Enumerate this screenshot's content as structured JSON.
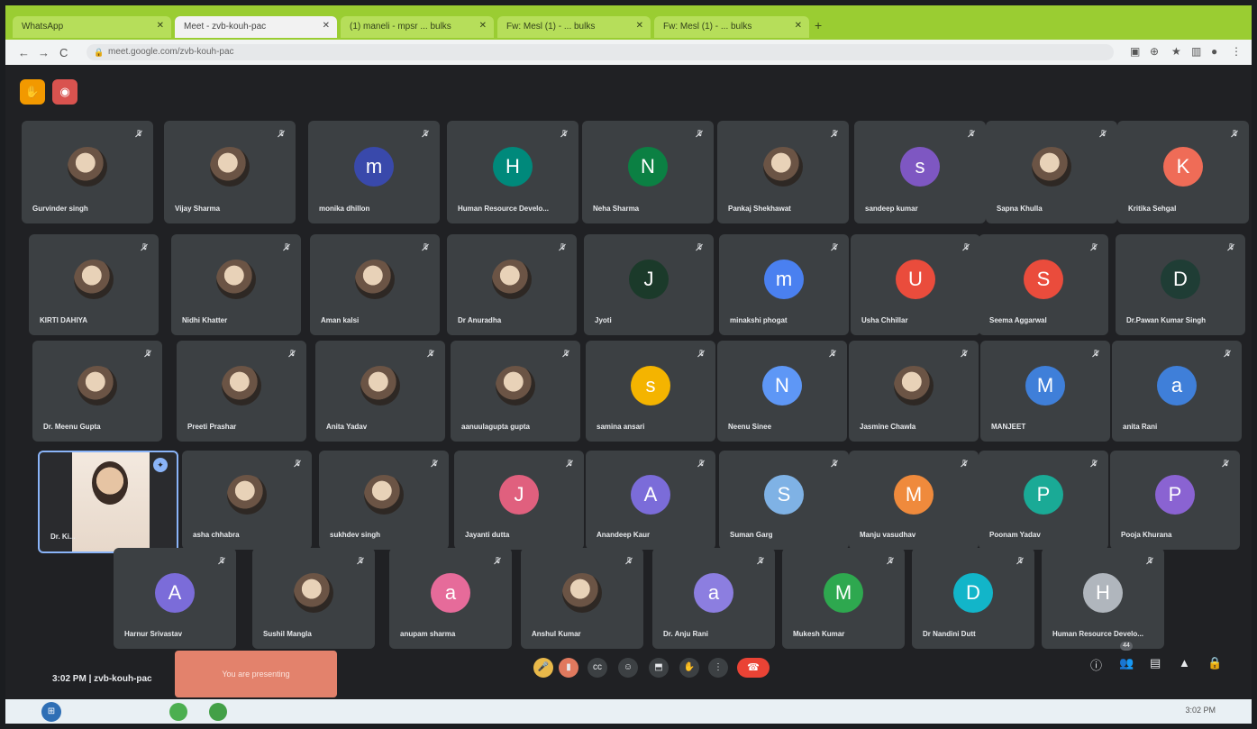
{
  "browser": {
    "tabs": [
      {
        "label": "WhatsApp",
        "active": false
      },
      {
        "label": "Meet - zvb-kouh-pac",
        "active": true
      },
      {
        "label": "(1) maneli - mpsr ... bulks",
        "active": false
      },
      {
        "label": "Fw: Mesl (1) - ... bulks",
        "active": false
      },
      {
        "label": "Fw: Mesl (1) - ... bulks",
        "active": false
      }
    ],
    "new_tab": "+",
    "url": "meet.google.com/zvb-kouh-pac",
    "lock": "🔒",
    "back": "←",
    "forward": "→",
    "reload": "C"
  },
  "meet": {
    "top_buttons": [
      "hand-icon",
      "record-icon"
    ],
    "participants": [
      {
        "name": "Gurvinder singh",
        "initial": "",
        "color": "",
        "photo": true
      },
      {
        "name": "Vijay Sharma",
        "initial": "",
        "color": "",
        "photo": true
      },
      {
        "name": "monika dhillon",
        "initial": "m",
        "color": "#3949ab",
        "photo": false
      },
      {
        "name": "Human Resource Develo...",
        "initial": "H",
        "color": "#00897b",
        "photo": false
      },
      {
        "name": "Neha Sharma",
        "initial": "N",
        "color": "#0b8043",
        "photo": false
      },
      {
        "name": "Pankaj Shekhawat",
        "initial": "",
        "color": "",
        "photo": true
      },
      {
        "name": "sandeep kumar",
        "initial": "s",
        "color": "#7e57c2",
        "photo": false
      },
      {
        "name": "Sapna Khulla",
        "initial": "",
        "color": "",
        "photo": true
      },
      {
        "name": "Kritika Sehgal",
        "initial": "K",
        "color": "#ef6c57",
        "photo": false
      },
      {
        "name": "KIRTI DAHIYA",
        "initial": "",
        "color": "",
        "photo": true
      },
      {
        "name": "Nidhi Khatter",
        "initial": "",
        "color": "",
        "photo": true
      },
      {
        "name": "Aman kalsi",
        "initial": "",
        "color": "",
        "photo": true
      },
      {
        "name": "Dr Anuradha",
        "initial": "",
        "color": "",
        "photo": true
      },
      {
        "name": "Jyoti",
        "initial": "J",
        "color": "#1b3a2a",
        "photo": false
      },
      {
        "name": "minakshi phogat",
        "initial": "m",
        "color": "#4a80f0",
        "photo": false
      },
      {
        "name": "Usha Chhillar",
        "initial": "U",
        "color": "#ea4c3c",
        "photo": false
      },
      {
        "name": "Seema Aggarwal",
        "initial": "S",
        "color": "#ea4c3c",
        "photo": false
      },
      {
        "name": "Dr.Pawan Kumar Singh",
        "initial": "D",
        "color": "#1f3d35",
        "photo": false
      },
      {
        "name": "Dr. Meenu Gupta",
        "initial": "",
        "color": "",
        "photo": true
      },
      {
        "name": "Preeti Prashar",
        "initial": "",
        "color": "",
        "photo": true
      },
      {
        "name": "Anita Yadav",
        "initial": "",
        "color": "",
        "photo": true
      },
      {
        "name": "aanuulagupta gupta",
        "initial": "",
        "color": "",
        "photo": true
      },
      {
        "name": "samina ansari",
        "initial": "s",
        "color": "#f4b400",
        "photo": false
      },
      {
        "name": "Neenu Sinee",
        "initial": "N",
        "color": "#5e97f6",
        "photo": false
      },
      {
        "name": "Jasmine Chawla",
        "initial": "",
        "color": "",
        "photo": true
      },
      {
        "name": "MANJEET",
        "initial": "M",
        "color": "#3f7fd9",
        "photo": false
      },
      {
        "name": "anita Rani",
        "initial": "a",
        "color": "#3f7fd9",
        "photo": false
      },
      {
        "name": "Dr. Ki...",
        "initial": "",
        "color": "",
        "photo": true,
        "self": true
      },
      {
        "name": "asha chhabra",
        "initial": "",
        "color": "",
        "photo": true
      },
      {
        "name": "sukhdev singh",
        "initial": "",
        "color": "",
        "photo": true
      },
      {
        "name": "Jayanti dutta",
        "initial": "J",
        "color": "#e0607e",
        "photo": false
      },
      {
        "name": "Anandeep Kaur",
        "initial": "A",
        "color": "#7b6cd9",
        "photo": false
      },
      {
        "name": "Suman Garg",
        "initial": "S",
        "color": "#7fb2e5",
        "photo": false
      },
      {
        "name": "Manju vasudhav",
        "initial": "M",
        "color": "#ef8a3c",
        "photo": false
      },
      {
        "name": "Poonam Yadav",
        "initial": "P",
        "color": "#1aaa96",
        "photo": false
      },
      {
        "name": "Pooja Khurana",
        "initial": "P",
        "color": "#8a63d2",
        "photo": false
      },
      {
        "name": "Harnur Srivastav",
        "initial": "A",
        "color": "#7b6cd9",
        "photo": false
      },
      {
        "name": "Sushil Mangla",
        "initial": "",
        "color": "",
        "photo": true
      },
      {
        "name": "anupam sharma",
        "initial": "a",
        "color": "#e66b9a",
        "photo": false
      },
      {
        "name": "Anshul Kumar",
        "initial": "",
        "color": "",
        "photo": true
      },
      {
        "name": "Dr. Anju Rani",
        "initial": "a",
        "color": "#8c7ee0",
        "photo": false
      },
      {
        "name": "Mukesh Kumar",
        "initial": "M",
        "color": "#2ea84f",
        "photo": false
      },
      {
        "name": "Dr Nandini Dutt",
        "initial": "D",
        "color": "#12b5c9",
        "photo": false
      },
      {
        "name": "Human Resource Develo...",
        "initial": "H",
        "color": "#b0b6bd",
        "photo": false
      }
    ],
    "bottom": {
      "time": "3:02 PM",
      "separator": "|",
      "meeting_code": "zvb-kouh-pac",
      "presenting": "You are presenting",
      "controls": [
        "mic-icon",
        "camera-icon",
        "captions-icon",
        "emoji-icon",
        "present-icon",
        "raise-hand-icon",
        "more-icon"
      ],
      "leave": "☎",
      "participant_count": "44"
    }
  },
  "taskbar": {
    "tray_text": "3:02 PM"
  }
}
